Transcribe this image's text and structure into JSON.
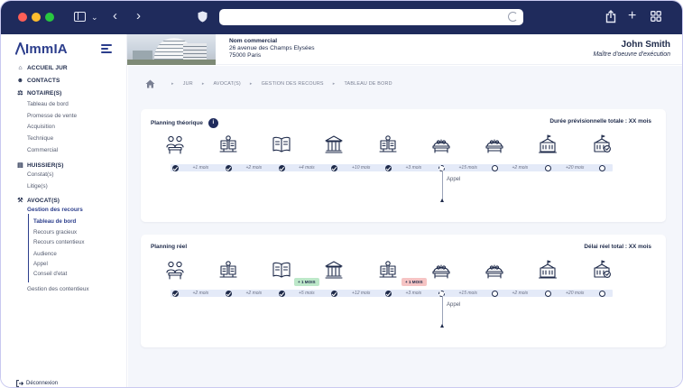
{
  "app": {
    "name": "ImmIA"
  },
  "sidebar": {
    "sections": [
      {
        "label": "ACCUEIL JUR",
        "icon": "home-icon"
      },
      {
        "label": "CONTACTS",
        "icon": "user-icon"
      },
      {
        "label": "NOTAIRE(S)",
        "icon": "scale-icon",
        "items": [
          "Tableau de bord",
          "Promesse de vente",
          "Acquisition",
          "Technique",
          "Commercial"
        ]
      },
      {
        "label": "HUISSIER(S)",
        "icon": "id-card-icon",
        "items": [
          "Constat(s)",
          "Litige(s)"
        ]
      },
      {
        "label": "AVOCAT(S)",
        "icon": "gavel-icon"
      }
    ],
    "avocat_group": "Gestion des recours",
    "avocat_subitems": [
      "Tableau de bord",
      "Recours gracieux",
      "Recours contentieux",
      "Audience",
      "Appel",
      "Conseil d'etat"
    ],
    "avocat_active": "Tableau de bord",
    "extra_item": "Gestion des contentieux",
    "logout": "Déconnexion"
  },
  "header": {
    "company_name": "Nom commercial",
    "address_line1": "26 avenue des Champs Elysées",
    "address_line2": "75000 Paris",
    "user_name": "John Smith",
    "user_role": "Maître d'oeuvre d'exécution"
  },
  "breadcrumb": [
    "JUR",
    "AVOCAT(S)",
    "GESTION DES RECOURS",
    "TABLEAU DE BORD"
  ],
  "planning_theorique": {
    "title": "Planning théorique",
    "info_badge": "i",
    "total": "Durée prévisionnelle totale : XX mois",
    "steps": [
      {
        "icon": "meeting-icon",
        "status": "done"
      },
      {
        "icon": "documents-icon",
        "status": "done"
      },
      {
        "icon": "book-icon",
        "status": "done"
      },
      {
        "icon": "courthouse-icon",
        "status": "done"
      },
      {
        "icon": "documents-icon",
        "status": "done"
      },
      {
        "icon": "hearing-icon",
        "status": "pending"
      },
      {
        "icon": "hearing-icon",
        "status": "todo"
      },
      {
        "icon": "government-icon",
        "status": "todo"
      },
      {
        "icon": "government-check-icon",
        "status": "todo"
      }
    ],
    "segments": [
      "+1 mois",
      "+2 mois",
      "+4 mois",
      "+10 mois",
      "+3 mois",
      "+15 mois",
      "+2 mois",
      "+20 mois"
    ],
    "marker_label": "Appel"
  },
  "planning_reel": {
    "title": "Planning réel",
    "total": "Délai réel total : XX mois",
    "steps": [
      {
        "icon": "meeting-icon",
        "status": "done"
      },
      {
        "icon": "documents-icon",
        "status": "done"
      },
      {
        "icon": "book-icon",
        "status": "done"
      },
      {
        "icon": "courthouse-icon",
        "status": "done"
      },
      {
        "icon": "documents-icon",
        "status": "done"
      },
      {
        "icon": "hearing-icon",
        "status": "pending"
      },
      {
        "icon": "hearing-icon",
        "status": "todo"
      },
      {
        "icon": "government-icon",
        "status": "todo"
      },
      {
        "icon": "government-check-icon",
        "status": "todo"
      }
    ],
    "segments": [
      "+2 mois",
      "+2 mois",
      "+5 mois",
      "+12 mois",
      "+3 mois",
      "+15 mois",
      "+2 mois",
      "+20 mois"
    ],
    "delays": [
      {
        "label": "+ 1 MOIS",
        "color": "#bde8c9"
      },
      {
        "label": "+ 1 MOIS",
        "color": "#f6c4c4"
      }
    ],
    "marker_label": "Appel"
  },
  "colors": {
    "navy": "#1f2b5c",
    "accent": "#2c3e8c",
    "track": "#e4eaf8",
    "background": "#f4f6fb"
  }
}
